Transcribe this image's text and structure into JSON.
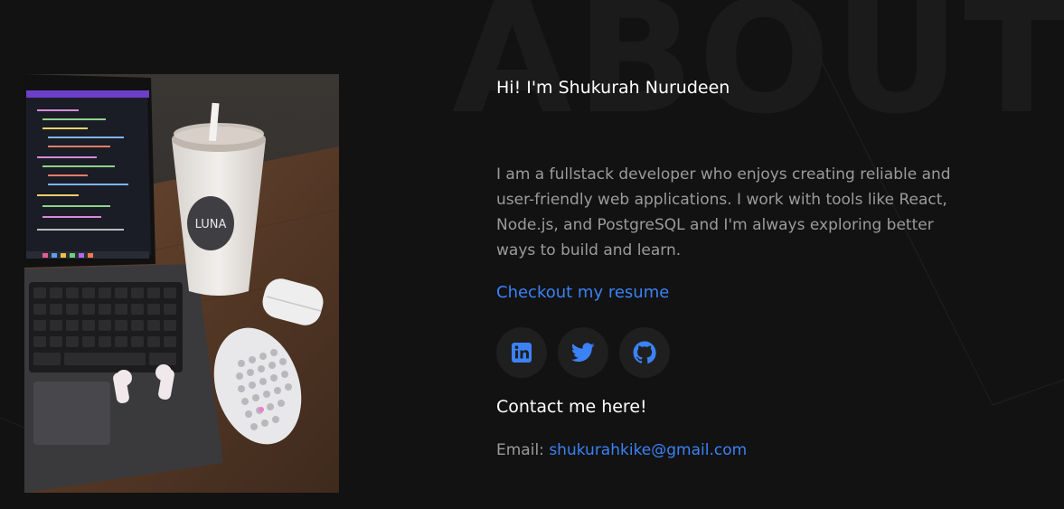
{
  "section": {
    "watermark": "ABOUT"
  },
  "about": {
    "greeting": "Hi! I'm Shukurah Nurudeen",
    "bio": "I am a fullstack developer who enjoys creating reliable and user-friendly web applications. I work with tools like React, Node.js, and PostgreSQL and I'm always exploring better ways to build and learn.",
    "resume_link": "Checkout my resume",
    "photo_cup_brand": "LUNA"
  },
  "socials": [
    {
      "name": "linkedin-icon"
    },
    {
      "name": "twitter-icon"
    },
    {
      "name": "github-icon"
    }
  ],
  "contact": {
    "heading": "Contact me here!",
    "email_label": "Email:",
    "email": "shukurahkike@gmail.com"
  },
  "colors": {
    "background": "#121212",
    "accent": "#3b82f6",
    "heading": "#ffffff",
    "body_text": "#9b9b9b",
    "icon_bg": "#1f1f1f"
  }
}
